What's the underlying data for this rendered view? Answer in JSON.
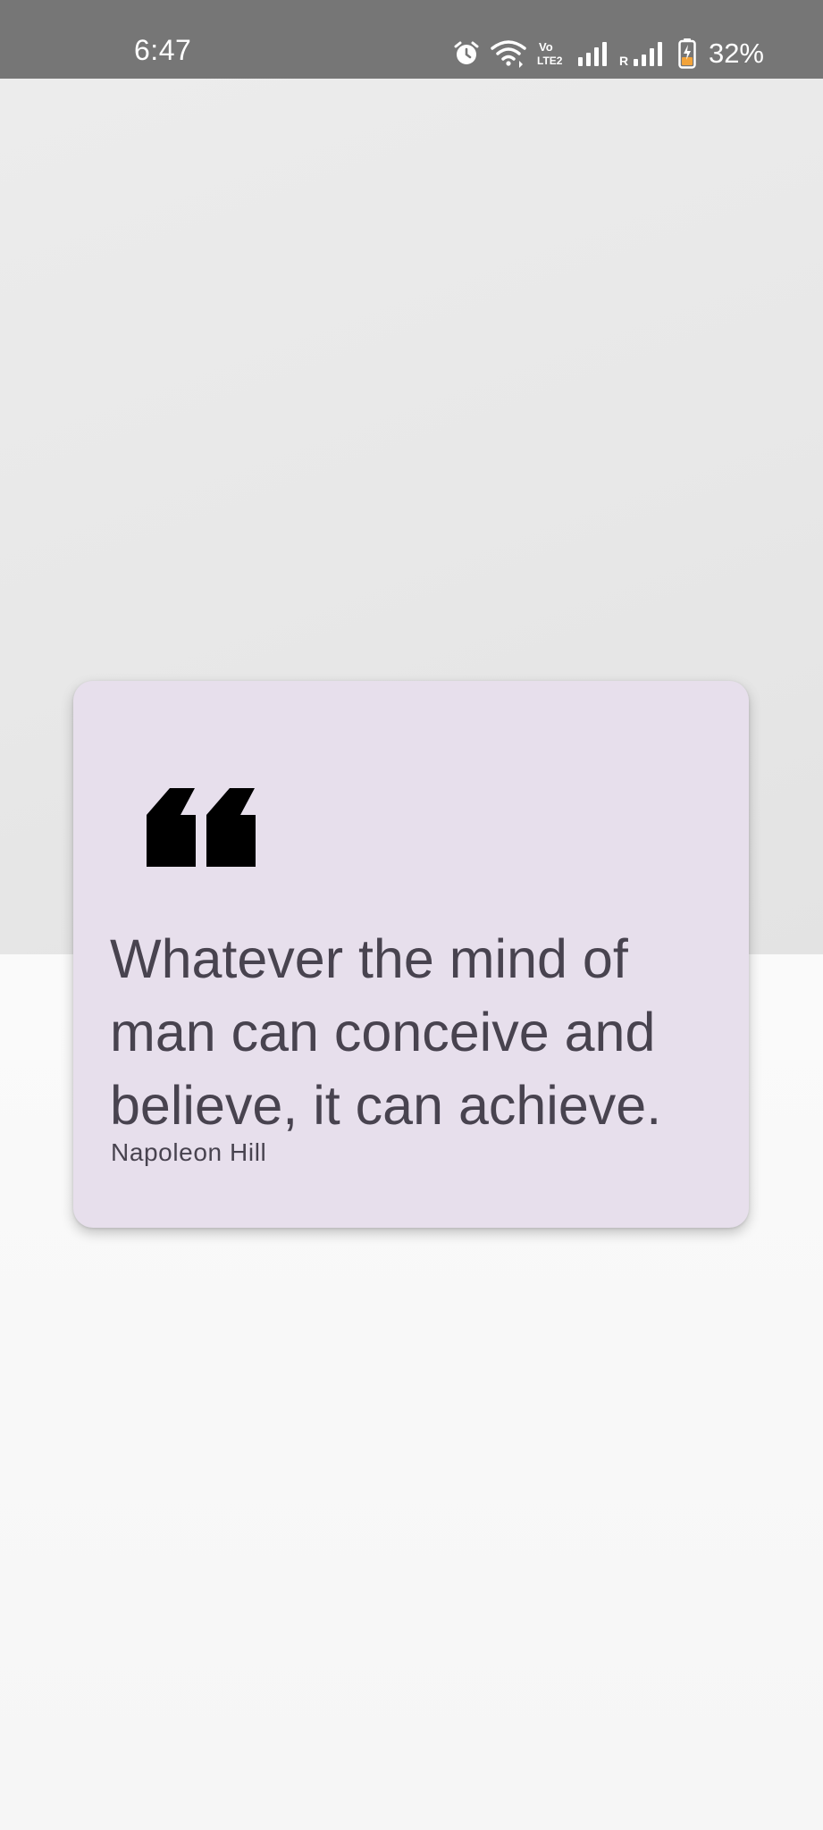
{
  "status_bar": {
    "time": "6:47",
    "battery_percent": "32%",
    "icons": [
      "alarm-icon",
      "wifi-icon",
      "volte-icon",
      "signal-icon",
      "roaming-signal-icon",
      "battery-charging-icon"
    ],
    "volte_label": "Vo LTE2",
    "roaming_label": "R",
    "background_color": "#767676"
  },
  "quote_card": {
    "quote_icon": "quote-mark-icon",
    "text": "Whatever the mind of man can conceive and believe, it can achieve.",
    "author": "Napoleon Hill",
    "background_color": "#e7dfec",
    "text_color": "#48434f"
  }
}
